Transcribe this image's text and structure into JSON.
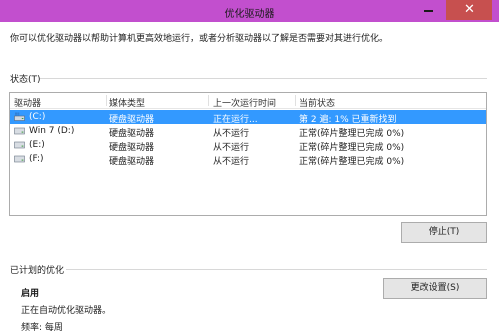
{
  "window": {
    "title": "优化驱动器",
    "close_glyph": "✕"
  },
  "description": "你可以优化驱动器以帮助计算机更高效地运行，或者分析驱动器以了解是否需要对其进行优化。",
  "status_section": {
    "label": "状态(T)",
    "columns": [
      "驱动器",
      "媒体类型",
      "上一次运行时间",
      "当前状态"
    ],
    "rows": [
      {
        "drive": "(C:)",
        "media": "硬盘驱动器",
        "last_run": "正在运行...",
        "status": "第 2 遍: 1% 已重新找到",
        "icon": "windows-drive-icon"
      },
      {
        "drive": "Win 7 (D:)",
        "media": "硬盘驱动器",
        "last_run": "从不运行",
        "status": "正常(碎片整理已完成 0%)",
        "icon": "hard-drive-icon"
      },
      {
        "drive": "(E:)",
        "media": "硬盘驱动器",
        "last_run": "从不运行",
        "status": "正常(碎片整理已完成 0%)",
        "icon": "hard-drive-icon"
      },
      {
        "drive": "(F:)",
        "media": "硬盘驱动器",
        "last_run": "从不运行",
        "status": "正常(碎片整理已完成 0%)",
        "icon": "hard-drive-icon"
      }
    ],
    "selected_row": 0,
    "stop_button": "停止(T)"
  },
  "schedule_section": {
    "label": "已计划的优化",
    "status": "启用",
    "description": "正在自动优化驱动器。",
    "frequency": "频率: 每周",
    "change_button": "更改设置(S)"
  },
  "colors": {
    "titlebar": "#c24fce",
    "close_button": "#c7504f",
    "selection": "#3399ff"
  }
}
